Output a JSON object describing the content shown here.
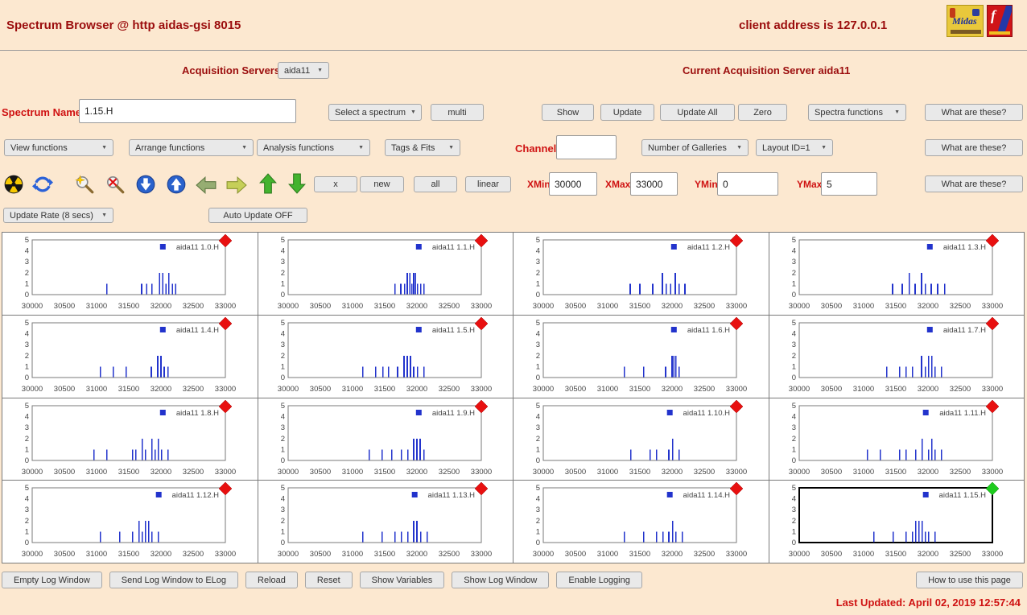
{
  "header": {
    "title": "Spectrum Browser @ http aidas-gsi 8015",
    "client": "client address is 127.0.0.1"
  },
  "logos": {
    "midas": "Midas"
  },
  "acquisition": {
    "label": "Acquisition Servers",
    "selected": "aida11",
    "current": "Current Acquisition Server aida11"
  },
  "common": {
    "what_are_these": "What are these?"
  },
  "spectrum_row": {
    "name_label": "Spectrum Name:",
    "name_value": "1.15.H",
    "select_spectrum": "Select a spectrum",
    "multi": "multi",
    "show": "Show",
    "update": "Update",
    "update_all": "Update All",
    "zero": "Zero",
    "spectra_functions": "Spectra functions"
  },
  "functions_row": {
    "view": "View functions",
    "arrange": "Arrange functions",
    "analysis": "Analysis functions",
    "tags": "Tags & Fits",
    "channel_label": "Channel:",
    "channel_value": "",
    "galleries": "Number of Galleries",
    "layout": "Layout ID=1"
  },
  "range_row": {
    "x": "x",
    "new": "new",
    "all": "all",
    "linear": "linear",
    "xmin_label": "XMin",
    "xmin": "30000",
    "xmax_label": "XMax",
    "xmax": "33000",
    "ymin_label": "YMin",
    "ymin": "0",
    "ymax_label": "YMax",
    "ymax": "5"
  },
  "update_row": {
    "rate": "Update Rate (8 secs)",
    "auto": "Auto Update OFF"
  },
  "toolbar_icons": [
    "radiation-icon",
    "refresh-icon",
    "zoom-in-icon",
    "zoom-out-icon",
    "globe-down-icon",
    "globe-up-icon",
    "arrow-left-icon",
    "arrow-right-icon",
    "arrow-up-icon",
    "arrow-down-icon"
  ],
  "footer": {
    "buttons": [
      "Empty Log Window",
      "Send Log Window to ELog",
      "Reload",
      "Reset",
      "Show Variables",
      "Show Log Window",
      "Enable Logging"
    ],
    "help": "How to use this page",
    "last_updated": "Last Updated: April 02, 2019 12:57:44"
  },
  "chart_data": {
    "type": "bar",
    "title": "Spectrum gallery 4x4",
    "xlim": [
      30000,
      33000
    ],
    "ylim": [
      0,
      5
    ],
    "x_ticks": [
      30000,
      30500,
      31000,
      31500,
      32000,
      32500,
      33000
    ],
    "y_ticks": [
      0,
      1,
      2,
      3,
      4,
      5
    ],
    "bar_color": "#2233cc",
    "panels": [
      {
        "name": "aida11 1.0.H",
        "marker": "#e81010",
        "selected": false,
        "spikes": [
          [
            31160,
            1
          ],
          [
            31700,
            1
          ],
          [
            31780,
            1
          ],
          [
            31860,
            1
          ],
          [
            31980,
            2
          ],
          [
            32030,
            2
          ],
          [
            32080,
            1
          ],
          [
            32120,
            2
          ],
          [
            32180,
            1
          ],
          [
            32230,
            1
          ]
        ]
      },
      {
        "name": "aida11 1.1.H",
        "marker": "#e81010",
        "selected": false,
        "spikes": [
          [
            31660,
            1
          ],
          [
            31750,
            1
          ],
          [
            31810,
            1
          ],
          [
            31850,
            2
          ],
          [
            31890,
            2
          ],
          [
            31920,
            1
          ],
          [
            31950,
            2
          ],
          [
            31980,
            2
          ],
          [
            32010,
            1
          ],
          [
            32060,
            1
          ],
          [
            32110,
            1
          ]
        ]
      },
      {
        "name": "aida11 1.2.H",
        "marker": "#e81010",
        "selected": false,
        "spikes": [
          [
            31350,
            1
          ],
          [
            31500,
            1
          ],
          [
            31700,
            1
          ],
          [
            31850,
            2
          ],
          [
            31910,
            1
          ],
          [
            31980,
            1
          ],
          [
            32050,
            2
          ],
          [
            32110,
            1
          ],
          [
            32200,
            1
          ]
        ]
      },
      {
        "name": "aida11 1.3.H",
        "marker": "#e81010",
        "selected": false,
        "spikes": [
          [
            31450,
            1
          ],
          [
            31600,
            1
          ],
          [
            31710,
            2
          ],
          [
            31800,
            1
          ],
          [
            31900,
            2
          ],
          [
            31960,
            1
          ],
          [
            32050,
            1
          ],
          [
            32150,
            1
          ],
          [
            32260,
            1
          ]
        ]
      },
      {
        "name": "aida11 1.4.H",
        "marker": "#e81010",
        "selected": false,
        "spikes": [
          [
            31060,
            1
          ],
          [
            31260,
            1
          ],
          [
            31460,
            1
          ],
          [
            31850,
            1
          ],
          [
            31950,
            2
          ],
          [
            32000,
            2
          ],
          [
            32050,
            1
          ],
          [
            32110,
            1
          ]
        ]
      },
      {
        "name": "aida11 1.5.H",
        "marker": "#e81010",
        "selected": false,
        "spikes": [
          [
            31160,
            1
          ],
          [
            31360,
            1
          ],
          [
            31470,
            1
          ],
          [
            31560,
            1
          ],
          [
            31700,
            1
          ],
          [
            31800,
            2
          ],
          [
            31850,
            2
          ],
          [
            31900,
            2
          ],
          [
            31950,
            1
          ],
          [
            32010,
            1
          ],
          [
            32110,
            1
          ]
        ]
      },
      {
        "name": "aida11 1.6.H",
        "marker": "#e81010",
        "selected": false,
        "spikes": [
          [
            31260,
            1
          ],
          [
            31560,
            1
          ],
          [
            31900,
            1
          ],
          [
            32000,
            2
          ],
          [
            32030,
            2
          ],
          [
            32060,
            2
          ],
          [
            32110,
            1
          ]
        ]
      },
      {
        "name": "aida11 1.7.H",
        "marker": "#e81010",
        "selected": false,
        "spikes": [
          [
            31360,
            1
          ],
          [
            31560,
            1
          ],
          [
            31660,
            1
          ],
          [
            31760,
            1
          ],
          [
            31900,
            2
          ],
          [
            31960,
            1
          ],
          [
            32010,
            2
          ],
          [
            32060,
            2
          ],
          [
            32110,
            1
          ],
          [
            32210,
            1
          ]
        ]
      },
      {
        "name": "aida11 1.8.H",
        "marker": "#e81010",
        "selected": false,
        "spikes": [
          [
            30960,
            1
          ],
          [
            31160,
            1
          ],
          [
            31560,
            1
          ],
          [
            31610,
            1
          ],
          [
            31710,
            2
          ],
          [
            31760,
            1
          ],
          [
            31860,
            2
          ],
          [
            31910,
            1
          ],
          [
            31960,
            2
          ],
          [
            32010,
            1
          ],
          [
            32110,
            1
          ]
        ]
      },
      {
        "name": "aida11 1.9.H",
        "marker": "#e81010",
        "selected": false,
        "spikes": [
          [
            31260,
            1
          ],
          [
            31460,
            1
          ],
          [
            31610,
            1
          ],
          [
            31760,
            1
          ],
          [
            31860,
            1
          ],
          [
            31950,
            2
          ],
          [
            32000,
            2
          ],
          [
            32050,
            2
          ],
          [
            32110,
            1
          ]
        ]
      },
      {
        "name": "aida11 1.10.H",
        "marker": "#e81010",
        "selected": false,
        "spikes": [
          [
            31360,
            1
          ],
          [
            31660,
            1
          ],
          [
            31760,
            1
          ],
          [
            31950,
            1
          ],
          [
            32010,
            2
          ],
          [
            32110,
            1
          ]
        ]
      },
      {
        "name": "aida11 1.11.H",
        "marker": "#e81010",
        "selected": false,
        "spikes": [
          [
            31060,
            1
          ],
          [
            31260,
            1
          ],
          [
            31560,
            1
          ],
          [
            31660,
            1
          ],
          [
            31810,
            1
          ],
          [
            31910,
            2
          ],
          [
            32010,
            1
          ],
          [
            32060,
            2
          ],
          [
            32110,
            1
          ],
          [
            32210,
            1
          ]
        ]
      },
      {
        "name": "aida11 1.12.H",
        "marker": "#e81010",
        "selected": false,
        "spikes": [
          [
            31060,
            1
          ],
          [
            31360,
            1
          ],
          [
            31560,
            1
          ],
          [
            31660,
            2
          ],
          [
            31710,
            1
          ],
          [
            31760,
            2
          ],
          [
            31810,
            2
          ],
          [
            31860,
            1
          ],
          [
            31960,
            1
          ]
        ]
      },
      {
        "name": "aida11 1.13.H",
        "marker": "#e81010",
        "selected": false,
        "spikes": [
          [
            31160,
            1
          ],
          [
            31460,
            1
          ],
          [
            31660,
            1
          ],
          [
            31760,
            1
          ],
          [
            31860,
            1
          ],
          [
            31950,
            2
          ],
          [
            32000,
            2
          ],
          [
            32060,
            1
          ],
          [
            32160,
            1
          ]
        ]
      },
      {
        "name": "aida11 1.14.H",
        "marker": "#e81010",
        "selected": false,
        "spikes": [
          [
            31260,
            1
          ],
          [
            31560,
            1
          ],
          [
            31760,
            1
          ],
          [
            31860,
            1
          ],
          [
            31950,
            1
          ],
          [
            32010,
            2
          ],
          [
            32060,
            1
          ],
          [
            32160,
            1
          ]
        ]
      },
      {
        "name": "aida11 1.15.H",
        "marker": "#1ecb1e",
        "selected": true,
        "spikes": [
          [
            31160,
            1
          ],
          [
            31460,
            1
          ],
          [
            31660,
            1
          ],
          [
            31760,
            1
          ],
          [
            31810,
            2
          ],
          [
            31860,
            2
          ],
          [
            31910,
            2
          ],
          [
            31960,
            1
          ],
          [
            32010,
            1
          ],
          [
            32110,
            1
          ]
        ]
      }
    ]
  }
}
